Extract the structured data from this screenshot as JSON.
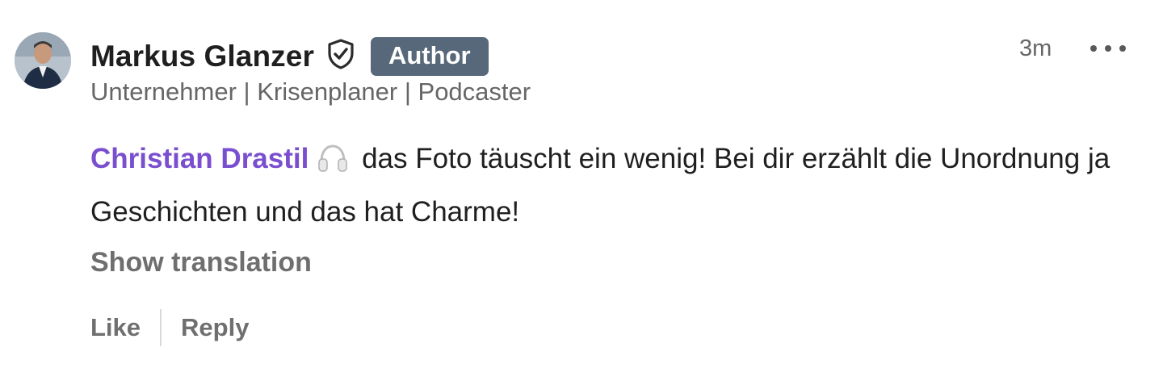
{
  "comment": {
    "author": {
      "name": "Markus Glanzer",
      "badge": "Author",
      "headline": "Unternehmer | Krisenplaner | Podcaster",
      "avatar_icon": "profile-photo",
      "verified_icon": "shield-check-icon"
    },
    "time": "3m",
    "more_icon": "ellipsis-icon",
    "body": {
      "mention": "Christian Drastil",
      "emoji_icon": "headphones-icon",
      "text": "das Foto täuscht ein wenig! Bei dir erzählt die Unordnung ja Geschichten und das hat Charme!"
    },
    "show_translation": "Show translation",
    "actions": {
      "like": "Like",
      "reply": "Reply"
    }
  },
  "colors": {
    "badge_bg": "#56687a",
    "mention": "#7a4fcf",
    "secondary_text": "#666666",
    "primary_text": "#1f1f1f"
  }
}
